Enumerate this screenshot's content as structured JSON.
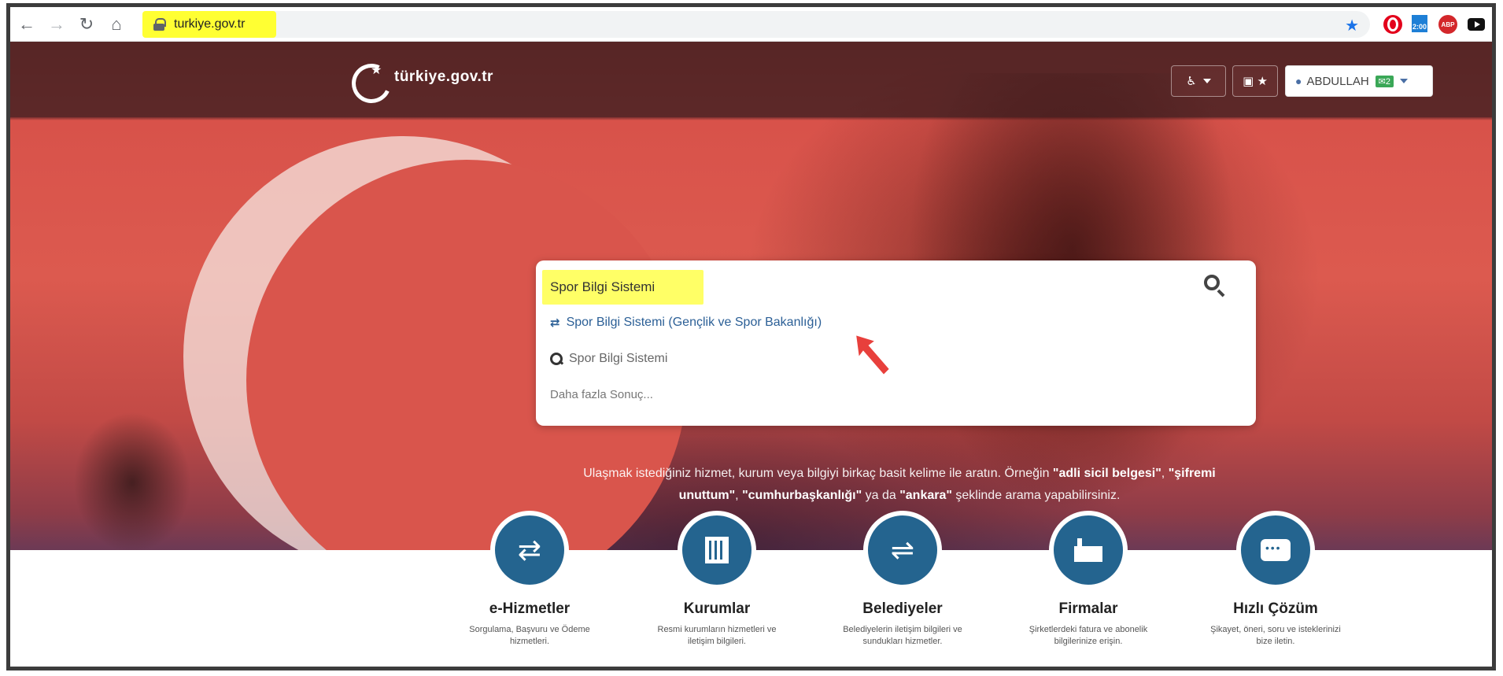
{
  "browser": {
    "url": "turkiye.gov.tr",
    "clock_badge": "2:00",
    "abp_label": "ABP"
  },
  "site": {
    "logo_text": "türkiye.gov.tr",
    "user_name": "ABDULLAH",
    "mail_count": "2"
  },
  "search": {
    "query": "Spor Bilgi Sistemi",
    "suggestions": [
      "Spor Bilgi Sistemi (Gençlik ve Spor Bakanlığı)",
      "Spor Bilgi Sistemi",
      "Daha fazla Sonuç..."
    ]
  },
  "hint": {
    "part1": "Ulaşmak istediğiniz hizmet, kurum veya bilgiyi birkaç basit kelime ile aratın. Örneğin ",
    "ex1": "\"adli sicil belgesi\"",
    "sep1": ", ",
    "ex2": "\"şifremi unuttum\"",
    "sep2": ", ",
    "ex3": "\"cumhurbaşkanlığı\"",
    "sep3": " ya da ",
    "ex4": "\"ankara\"",
    "part2": " şeklinde arama yapabilirsiniz."
  },
  "features": [
    {
      "title": "e-Hizmetler",
      "desc": "Sorgulama, Başvuru ve Ödeme hizmetleri.",
      "icon": "refresh-icon"
    },
    {
      "title": "Kurumlar",
      "desc": "Resmi kurumların hizmetleri ve iletişim bilgileri.",
      "icon": "building-icon"
    },
    {
      "title": "Belediyeler",
      "desc": "Belediyelerin iletişim bilgileri ve sundukları hizmetler.",
      "icon": "signpost-icon"
    },
    {
      "title": "Firmalar",
      "desc": "Şirketlerdeki fatura ve abonelik bilgilerinize erişin.",
      "icon": "factory-icon"
    },
    {
      "title": "Hızlı Çözüm",
      "desc": "Şikayet, öneri, soru ve isteklerinizi bize iletin.",
      "icon": "chat-icon"
    }
  ],
  "colors": {
    "accent_blue": "#24648f",
    "highlight_yellow": "#ffff33",
    "annotation_arrow": "#e8403c"
  }
}
